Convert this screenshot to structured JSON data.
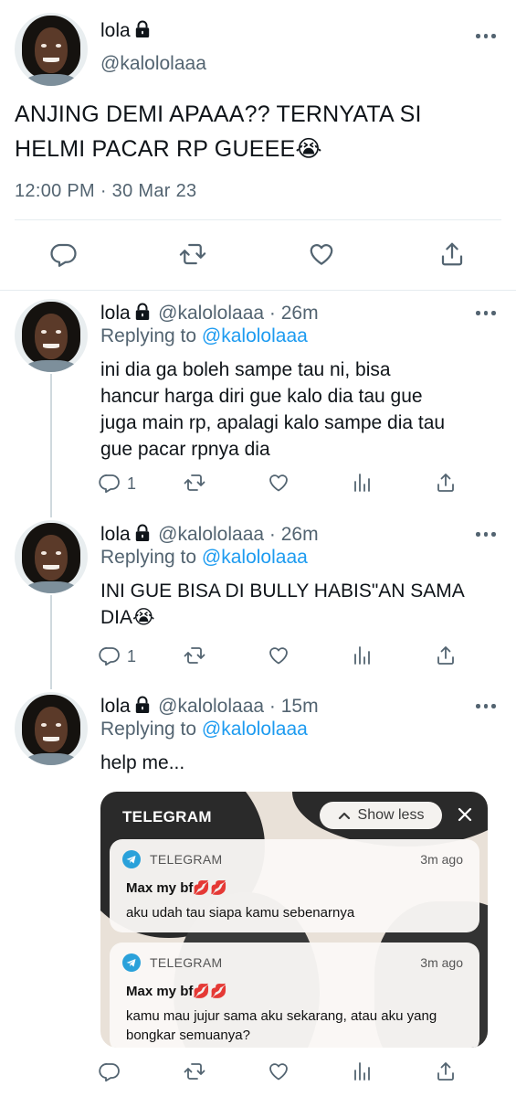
{
  "main_tweet": {
    "author_name": "lola",
    "author_handle": "@kalololaaa",
    "text_line1": "ANJING DEMI APAAA?? TERNYATA SI",
    "text_line2": "HELMI PACAR RP GUEEE😭",
    "timestamp": "12:00 PM · 30 Mar 23"
  },
  "replies": [
    {
      "author_name": "lola",
      "handle_time": "@kalololaaa · 26m",
      "replying_label": "Replying to",
      "replying_handle": "@kalololaaa",
      "lines": [
        "ini dia ga boleh sampe tau ni, bisa",
        "hancur harga diri gue kalo dia tau gue",
        "juga main rp, apalagi kalo sampe dia tau",
        "gue pacar rpnya dia"
      ],
      "reply_count": "1"
    },
    {
      "author_name": "lola",
      "handle_time": "@kalololaaa · 26m",
      "replying_label": "Replying to",
      "replying_handle": "@kalololaaa",
      "lines": [
        "INI GUE BISA DI BULLY HABIS\"AN SAMA",
        "DIA😭"
      ],
      "reply_count": "1"
    },
    {
      "author_name": "lola",
      "handle_time": "@kalololaaa · 15m",
      "replying_label": "Replying to",
      "replying_handle": "@kalololaaa",
      "lines": [
        "help me..."
      ],
      "reply_count": ""
    }
  ],
  "telegram": {
    "header": "TELEGRAM",
    "show_less": "Show less",
    "notifications": [
      {
        "app": "TELEGRAM",
        "time": "3m ago",
        "sender": "Max my bf💋💋",
        "message": "aku udah tau siapa kamu sebenarnya"
      },
      {
        "app": "TELEGRAM",
        "time": "3m ago",
        "sender": "Max my bf💋💋",
        "message": "kamu mau jujur sama aku sekarang, atau aku yang bongkar semuanya?"
      }
    ]
  },
  "icons": {
    "action_bar": [
      "reply-icon",
      "retweet-icon",
      "like-icon",
      "analytics-icon",
      "share-icon"
    ],
    "more": "more-options-icon",
    "lock": "lock-icon"
  },
  "colors": {
    "text": "#0f1419",
    "secondary": "#536471",
    "link": "#1d9bf0",
    "divider": "#e6ecf0",
    "telegram_blue": "#2aa1da"
  }
}
